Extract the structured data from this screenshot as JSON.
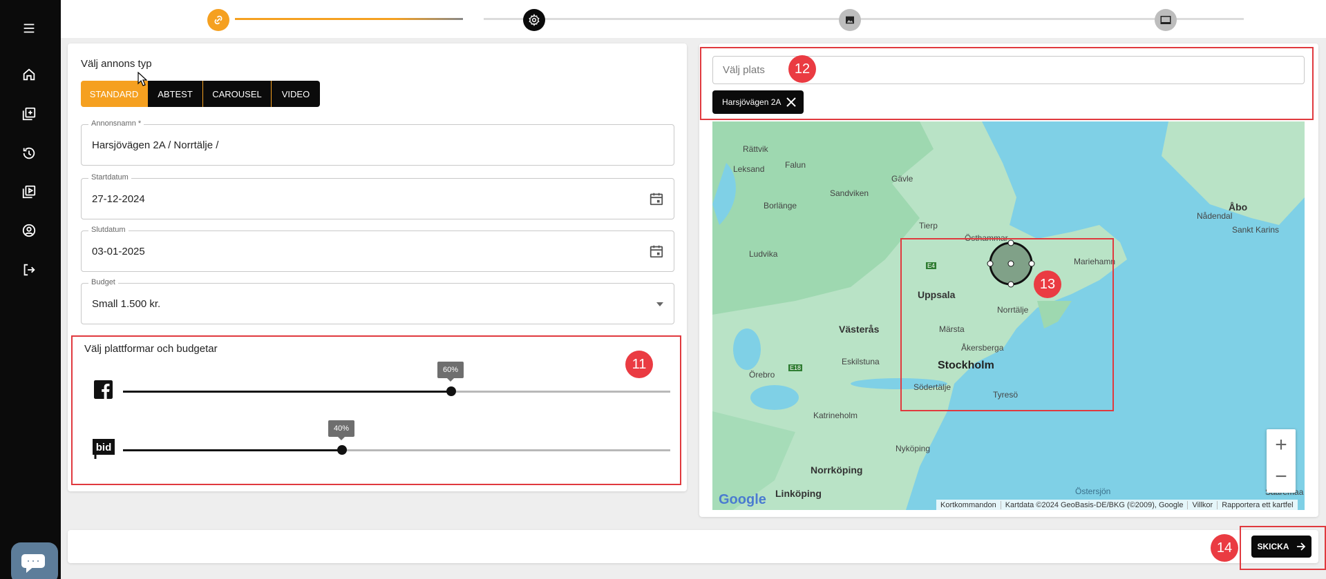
{
  "colors": {
    "accent": "#f5a020",
    "sidebar": "#0b0b0b",
    "annotation": "#e0393e"
  },
  "sidebar": {
    "items": [
      {
        "icon": "menu-icon"
      },
      {
        "icon": "home-icon"
      },
      {
        "icon": "add-ad-icon"
      },
      {
        "icon": "history-icon"
      },
      {
        "icon": "video-library-icon"
      },
      {
        "icon": "account-icon"
      },
      {
        "icon": "logout-icon"
      }
    ],
    "chat_icon": "chat-icon"
  },
  "stepper": {
    "steps": [
      {
        "icon": "link-icon",
        "state": "done"
      },
      {
        "icon": "gear-icon",
        "state": "active"
      },
      {
        "icon": "image-icon",
        "state": "pending"
      },
      {
        "icon": "monitor-icon",
        "state": "pending"
      }
    ]
  },
  "form": {
    "ad_type_title": "Välj annons typ",
    "ad_types": [
      "STANDARD",
      "ABTEST",
      "CAROUSEL",
      "VIDEO"
    ],
    "selected_ad_type": "STANDARD",
    "ad_name": {
      "label": "Annonsnamn *",
      "value": "Harsjövägen 2A / Norrtälje /"
    },
    "start_date": {
      "label": "Startdatum",
      "value": "27-12-2024"
    },
    "end_date": {
      "label": "Slutdatum",
      "value": "03-01-2025"
    },
    "budget": {
      "label": "Budget",
      "value": "Small 1.500 kr."
    }
  },
  "platforms": {
    "title": "Välj plattformar och budgetar",
    "sliders": [
      {
        "platform": "facebook",
        "icon": "facebook-icon",
        "value": 0.6,
        "label": "60%"
      },
      {
        "platform": "bid",
        "icon": "bid-icon",
        "value": 0.4,
        "label": "40%"
      }
    ]
  },
  "location": {
    "placeholder": "Välj plats",
    "chips": [
      "Harsjövägen 2A"
    ]
  },
  "map": {
    "labels": [
      "Rättvik",
      "Leksand",
      "Falun",
      "Gävle",
      "Borlänge",
      "Sandviken",
      "Åbo",
      "Nådendal",
      "Sankt Karins",
      "Tierp",
      "Östhammar",
      "Ludvika",
      "Mariehamn",
      "Uppsala",
      "Norrtälje",
      "Märsta",
      "Västerås",
      "Åkersberga",
      "Eskilstuna",
      "Stockholm",
      "Örebro",
      "Södertälje",
      "Tyresö",
      "Katrineholm",
      "Nyköping",
      "Norrköping",
      "Linköping",
      "Östersjön",
      "Saaremaa",
      "E4",
      "E18"
    ],
    "attribution": [
      "Kortkommandon",
      "Kartdata ©2024 GeoBasis-DE/BKG (©2009), Google",
      "Villkor",
      "Rapportera ett kartfel"
    ],
    "google": "Google",
    "zoom_in": "+",
    "zoom_out": "−"
  },
  "annotations": [
    "11",
    "12",
    "13",
    "14"
  ],
  "footer": {
    "send_label": "SKICKA"
  }
}
